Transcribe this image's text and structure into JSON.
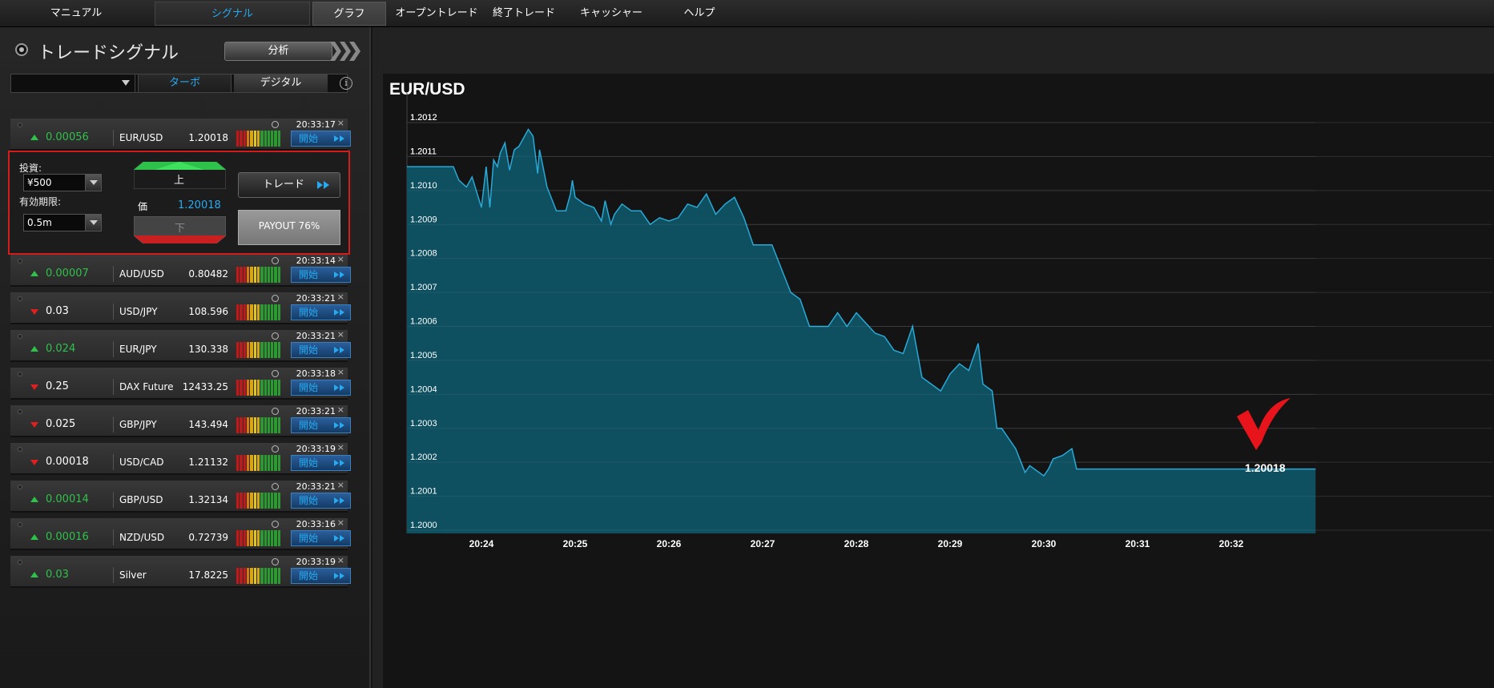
{
  "nav": {
    "tabs": [
      {
        "label": "マニュアル"
      },
      {
        "label": "シグナル"
      },
      {
        "label": "グラフ"
      },
      {
        "label": "オープントレード"
      },
      {
        "label": "終了トレード"
      },
      {
        "label": "キャッシャー"
      },
      {
        "label": "ヘルプ"
      }
    ]
  },
  "signals": {
    "title": "トレードシグナル",
    "analyze_label": "分析",
    "filter": {
      "dropdown_value": "",
      "tab_turbo": "ターボ",
      "tab_digital": "デジタル",
      "info_icon": "info-icon"
    },
    "start_label": "開始",
    "rows": [
      {
        "direction": "up",
        "change": "0.00056",
        "symbol": "EUR/USD",
        "price": "1.20018",
        "time": "20:33:17"
      },
      {
        "direction": "up",
        "change": "0.00007",
        "symbol": "AUD/USD",
        "price": "0.80482",
        "time": "20:33:14"
      },
      {
        "direction": "down",
        "change": "0.03",
        "symbol": "USD/JPY",
        "price": "108.596",
        "time": "20:33:21"
      },
      {
        "direction": "up",
        "change": "0.024",
        "symbol": "EUR/JPY",
        "price": "130.338",
        "time": "20:33:21"
      },
      {
        "direction": "down",
        "change": "0.25",
        "symbol": "DAX Future",
        "price": "12433.25",
        "time": "20:33:18"
      },
      {
        "direction": "down",
        "change": "0.025",
        "symbol": "GBP/JPY",
        "price": "143.494",
        "time": "20:33:21"
      },
      {
        "direction": "down",
        "change": "0.00018",
        "symbol": "USD/CAD",
        "price": "1.21132",
        "time": "20:33:19"
      },
      {
        "direction": "up",
        "change": "0.00014",
        "symbol": "GBP/USD",
        "price": "1.32134",
        "time": "20:33:21"
      },
      {
        "direction": "up",
        "change": "0.00016",
        "symbol": "NZD/USD",
        "price": "0.72739",
        "time": "20:33:16"
      },
      {
        "direction": "up",
        "change": "0.03",
        "symbol": "Silver",
        "price": "17.8225",
        "time": "20:33:19"
      }
    ],
    "expanded": {
      "investment_label": "投資:",
      "investment_value": "¥500",
      "expiry_label": "有効期限:",
      "expiry_value": "0.5m",
      "up_label": "上",
      "down_label": "下",
      "price_label": "価",
      "price_value": "1.20018",
      "trade_label": "トレード",
      "payout_label": "PAYOUT 76%"
    }
  },
  "colors": {
    "accent": "#27aaf0",
    "up": "#2fc24a",
    "down": "#e02020",
    "area": "#0e4f60",
    "line": "#2aa8d6",
    "check": "#e8141b"
  },
  "chart_data": {
    "type": "area",
    "title": "EUR/USD",
    "y_ticks": [
      "1.2012",
      "1.2011",
      "1.2010",
      "1.2009",
      "1.2008",
      "1.2007",
      "1.2006",
      "1.2005",
      "1.2004",
      "1.2003",
      "1.2002",
      "1.2001",
      "1.2000"
    ],
    "x_ticks": [
      "20:24",
      "20:25",
      "20:26",
      "20:27",
      "20:28",
      "20:29",
      "20:30",
      "20:31",
      "20:32"
    ],
    "ylim": [
      1.2,
      1.2013
    ],
    "current_value_label": "1.20018",
    "x": [
      23.7,
      23.76,
      23.84,
      23.9,
      24.0,
      24.05,
      24.09,
      24.13,
      24.17,
      24.2,
      24.25,
      24.3,
      24.35,
      24.4,
      24.5,
      24.55,
      24.6,
      24.62,
      24.65,
      24.7,
      24.8,
      24.9,
      24.95,
      24.97,
      25.0,
      25.1,
      25.2,
      25.28,
      25.32,
      25.38,
      25.42,
      25.5,
      25.6,
      25.7,
      25.8,
      25.9,
      26.0,
      26.1,
      26.2,
      26.3,
      26.4,
      26.5,
      26.6,
      26.7,
      26.8,
      26.9,
      27.0,
      27.1,
      27.2,
      27.3,
      27.4,
      27.5,
      27.6,
      27.7,
      27.8,
      27.9,
      28.0,
      28.1,
      28.2,
      28.3,
      28.35,
      28.4,
      28.5,
      28.6,
      28.7,
      28.8,
      28.9,
      29.0,
      29.1,
      29.2,
      29.3,
      29.35,
      29.45,
      29.5,
      29.55,
      29.6,
      29.7,
      29.8,
      29.85,
      29.9,
      30.0,
      30.05,
      30.1,
      30.2,
      30.3,
      30.35,
      30.4,
      30.5,
      30.55,
      30.6,
      30.65,
      30.7,
      30.8,
      30.85,
      30.9,
      31.0,
      31.05,
      31.1,
      31.2,
      31.3,
      31.4,
      31.5,
      31.6,
      31.7,
      31.8,
      31.9,
      32.0,
      32.1,
      32.2,
      32.3,
      32.4,
      32.45,
      32.5,
      32.6,
      32.7,
      32.9
    ],
    "values": [
      1.20107,
      1.20103,
      1.20101,
      1.20104,
      1.20095,
      1.20107,
      1.20095,
      1.20109,
      1.20107,
      1.20111,
      1.20114,
      1.20106,
      1.20112,
      1.20113,
      1.20118,
      1.20116,
      1.20105,
      1.20112,
      1.20108,
      1.20101,
      1.20094,
      1.20094,
      1.20099,
      1.20103,
      1.20098,
      1.20096,
      1.20095,
      1.20091,
      1.20097,
      1.2009,
      1.20093,
      1.20096,
      1.20094,
      1.20094,
      1.2009,
      1.20092,
      1.20091,
      1.20092,
      1.20096,
      1.20095,
      1.20099,
      1.20093,
      1.20096,
      1.20098,
      1.20092,
      1.20084,
      1.20084,
      1.20084,
      1.20077,
      1.2007,
      1.20068,
      1.2006,
      1.2006,
      1.2006,
      1.20064,
      1.2006,
      1.20064,
      1.20061,
      1.20058,
      1.20057,
      1.20055,
      1.20053,
      1.20052,
      1.2006,
      1.20045,
      1.20043,
      1.20041,
      1.20046,
      1.20049,
      1.20047,
      1.20055,
      1.20043,
      1.20041,
      1.2003,
      1.2003,
      1.20028,
      1.20024,
      1.20017,
      1.20019,
      1.20018,
      1.20016,
      1.20018,
      1.20021,
      1.20022,
      1.20024,
      1.20018,
      1.20018,
      1.20018,
      1.20018,
      1.20018,
      1.20018,
      1.20018,
      1.20018,
      1.20018,
      1.20018,
      1.20018,
      1.20018,
      1.20018,
      1.20018,
      1.20018,
      1.20018,
      1.20018,
      1.20018,
      1.20018,
      1.20018,
      1.20018,
      1.20018,
      1.20018,
      1.20018,
      1.20018,
      1.20018,
      1.20018,
      1.20018,
      1.20018,
      1.20018,
      1.20018
    ],
    "grid": true,
    "legend": "none"
  }
}
